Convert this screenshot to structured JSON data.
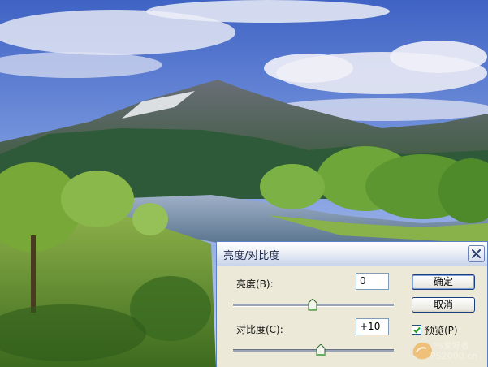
{
  "dialog": {
    "title": "亮度/对比度",
    "brightness": {
      "label": "亮度(B):",
      "value": "0",
      "slider_position": 0.5
    },
    "contrast": {
      "label": "对比度(C):",
      "value": "+10",
      "slider_position": 0.55
    },
    "ok_label": "确定",
    "cancel_label": "取消",
    "preview": {
      "label": "预览(P)",
      "checked": true
    }
  },
  "watermark": {
    "line1": "PS爱好者",
    "line2": "PS2000.cn"
  }
}
